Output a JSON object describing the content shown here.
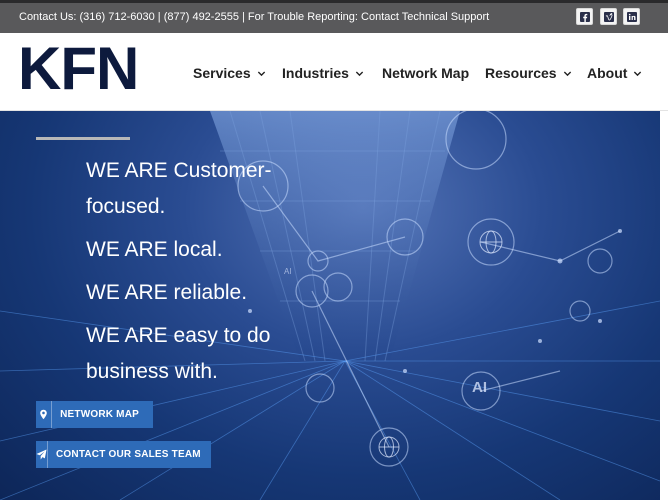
{
  "topbar": {
    "contact_text": "Contact Us: (316) 712-6030 | (877) 492-2555 | For Trouble Reporting: Contact Technical Support",
    "social": [
      "facebook-icon",
      "vimeo-icon",
      "linkedin-icon"
    ]
  },
  "header": {
    "logo_text": "KFN",
    "nav": [
      {
        "label": "Services",
        "has_dropdown": true
      },
      {
        "label": "Industries",
        "has_dropdown": true
      },
      {
        "label": "Network Map",
        "has_dropdown": false
      },
      {
        "label": "Resources",
        "has_dropdown": true
      },
      {
        "label": "About",
        "has_dropdown": true
      }
    ]
  },
  "hero": {
    "lines": [
      "WE ARE Customer-focused.",
      "WE ARE local.",
      "WE ARE reliable.",
      "WE ARE easy to do business with."
    ],
    "buttons": [
      {
        "label": "NETWORK MAP",
        "icon": "map-pin-icon"
      },
      {
        "label": "CONTACT OUR SALES TEAM",
        "icon": "paper-plane-icon"
      }
    ],
    "overlay_labels": [
      "AI",
      "AI"
    ]
  },
  "colors": {
    "topbar_bg": "#59595b",
    "logo": "#0d1a3d",
    "nav_text": "#222222",
    "button_bg": "#2e6bb8",
    "hero_bg": "#163775"
  }
}
